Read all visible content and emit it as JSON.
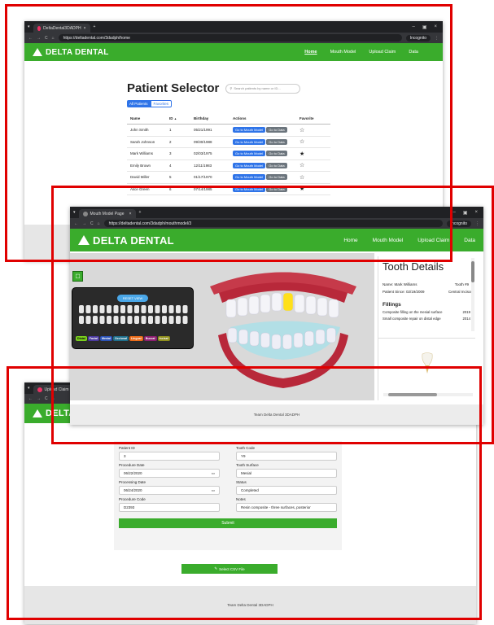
{
  "win1": {
    "tab_title": "DeltaDental3DADPH",
    "url": "https://deltadental.com/3dadph/home",
    "incognito": "Incognito",
    "brand": "DELTA DENTAL",
    "nav": [
      "Home",
      "Mouth Model",
      "Upload Claim",
      "Data"
    ],
    "page_title": "Patient Selector",
    "search_placeholder": "Search patients by name or ID...",
    "filter_all": "All Patients",
    "filter_fav": "Favorites",
    "headers": {
      "name": "Name",
      "id": "ID",
      "sort_arrow": "▲",
      "birthday": "Birthday",
      "actions": "Actions",
      "favorite": "Favorite"
    },
    "btn_mouth": "Go to Mouth Model",
    "btn_data": "Go to Data",
    "rows": [
      {
        "name": "John Smith",
        "id": "1",
        "birthday": "05/21/1991",
        "star": "☆"
      },
      {
        "name": "Sarah Johnson",
        "id": "2",
        "birthday": "09/30/1988",
        "star": "☆"
      },
      {
        "name": "Mark Williams",
        "id": "3",
        "birthday": "02/03/1975",
        "star": "★"
      },
      {
        "name": "Emily Brown",
        "id": "4",
        "birthday": "12/11/1983",
        "star": "☆"
      },
      {
        "name": "David Miller",
        "id": "5",
        "birthday": "01/17/1970",
        "star": "☆"
      },
      {
        "name": "Alice Green",
        "id": "6",
        "birthday": "07/14/1985",
        "star": "★"
      }
    ]
  },
  "win2": {
    "tab_title": "Mouth Model Page",
    "url": "https://deltadental.com/3dadph/mouthmodel/3",
    "incognito": "Incognito",
    "brand": "DELTA DENTAL",
    "nav": [
      "Home",
      "Mouth Model",
      "Upload Claim",
      "Data"
    ],
    "reset_view": "RESET VIEW",
    "surfaces": [
      "Distal",
      "Facial",
      "Mesial",
      "Occlusal",
      "Lingual",
      "Buccal",
      "Incisal"
    ],
    "details_title": "Tooth Details",
    "name_line": "Name: Mark Williams",
    "tooth_line": "Tooth #9",
    "since_line": "Patient Since: 02/19/2009",
    "central_line": "Central Incisor",
    "fillings_heading": "Fillings",
    "fillings": [
      {
        "text": "Composite filling on the mesial surface",
        "year": "2019"
      },
      {
        "text": "Small composite repair on distal edge",
        "year": "2014"
      }
    ],
    "footer": "Team Delta Dental 3DADPH"
  },
  "win3": {
    "tab_title": "Upload Claim",
    "brand": "DELTA DENTAL",
    "patient_id_label": "Patient ID",
    "patient_id": "3",
    "tooth_code_label": "Tooth Code",
    "tooth_code": "Y9",
    "procedure_date_label": "Procedure Date",
    "procedure_date": "06/22/2020",
    "tooth_surface_label": "Tooth Surface",
    "tooth_surface": "Mesial",
    "processing_date_label": "Processing Date",
    "processing_date": "06/24/2020",
    "status_label": "Status",
    "status": "Completed",
    "procedure_code_label": "Procedure Code",
    "procedure_code": "D2393",
    "notes_label": "Notes",
    "notes": "Resin composite - three surfaces, posterior",
    "submit": "Submit",
    "csv": "Select CSV File",
    "footer": "Team Delta Dental 3DADPH"
  }
}
